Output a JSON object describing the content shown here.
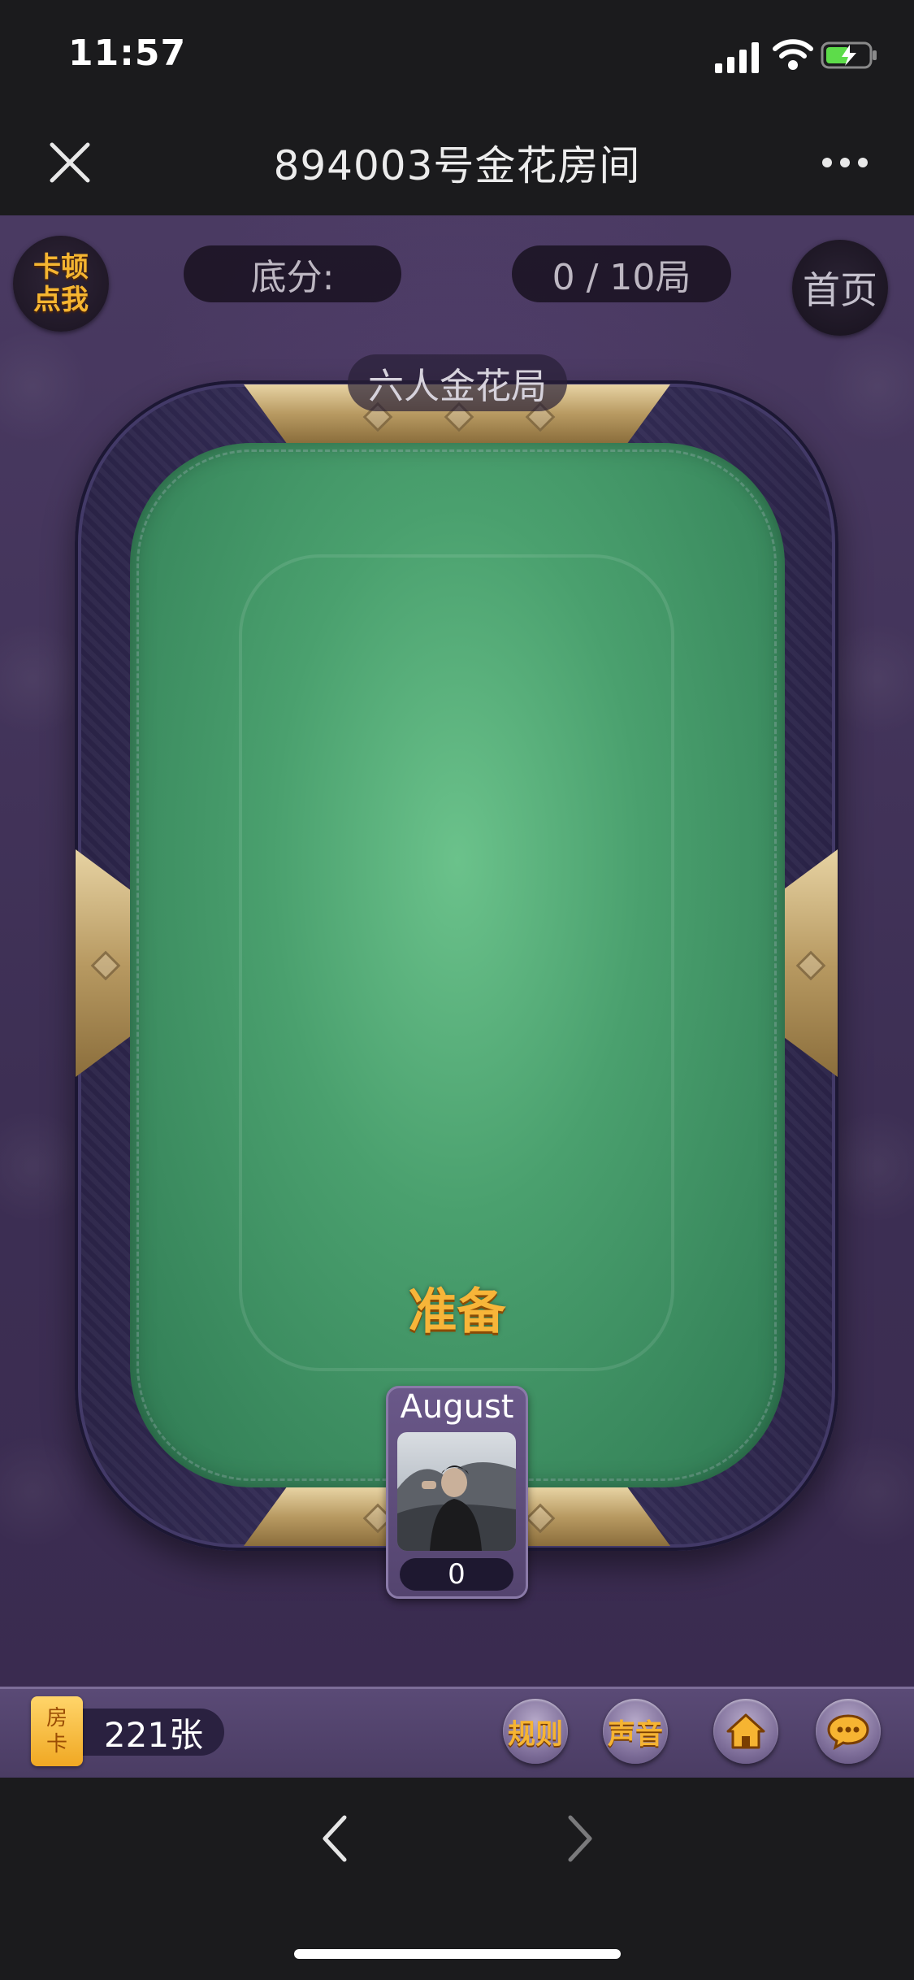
{
  "status_bar": {
    "time": "11:57"
  },
  "nav": {
    "title": "894003号金花房间"
  },
  "game": {
    "lag_button": {
      "line1": "卡顿",
      "line2": "点我"
    },
    "base_score_label": "底分:",
    "rounds_label": "0 / 10局",
    "home_label": "首页",
    "table_label": "六人金花局",
    "ready_label": "准备",
    "player": {
      "name": "August",
      "score": "0"
    }
  },
  "toolbar": {
    "room_card": {
      "line1": "房",
      "line2": "卡"
    },
    "card_count": "221张",
    "rules_label": "规则",
    "sound_label": "声音"
  },
  "colors": {
    "accent_gold": "#f7b539",
    "felt_green": "#4aa06e",
    "background_purple": "#3d2f54"
  },
  "icons": [
    "close-icon",
    "more-icon",
    "home-icon",
    "chat-icon",
    "back-arrow-icon",
    "forward-arrow-icon"
  ]
}
